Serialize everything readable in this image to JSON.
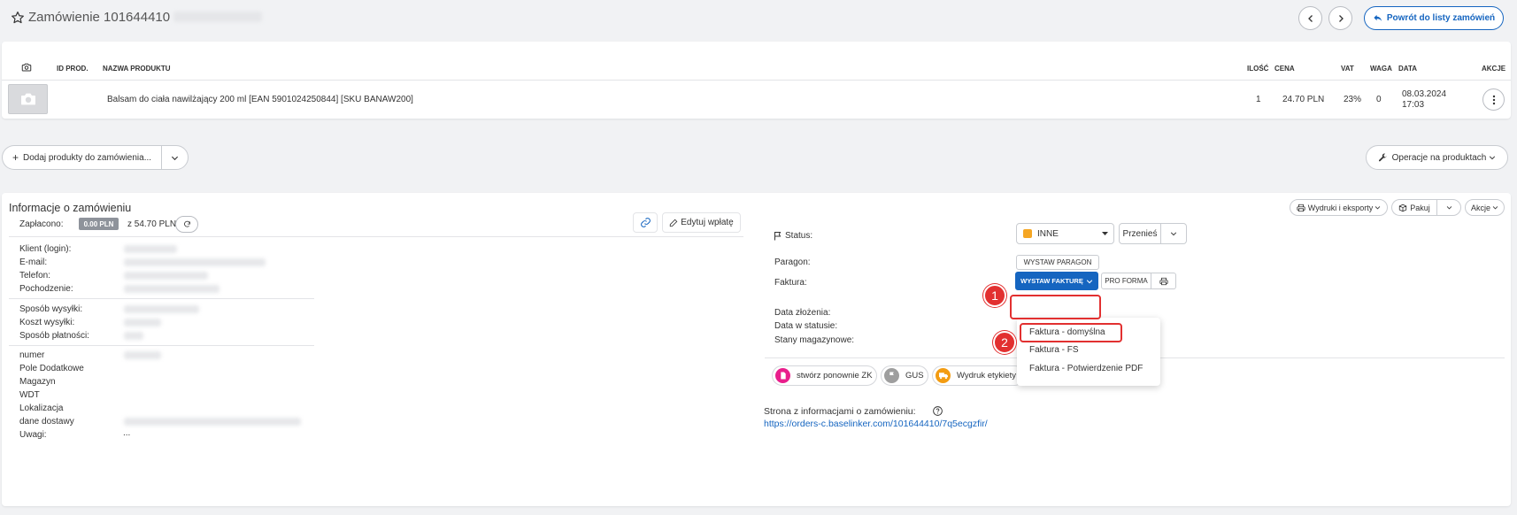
{
  "header": {
    "title": "Zamówienie 101644410",
    "back_label": "Powrót do listy zamówień"
  },
  "products_table": {
    "columns": [
      "ID PROD.",
      "NAZWA PRODUKTU",
      "ILOŚĆ",
      "CENA",
      "VAT",
      "WAGA",
      "DATA",
      "AKCJE"
    ],
    "rows": [
      {
        "name": "Balsam do ciała nawilżający 200 ml [EAN 5901024250844] [SKU BANAW200]",
        "qty": "1",
        "price": "24.70 PLN",
        "vat": "23%",
        "weight": "0",
        "date_line1": "08.03.2024",
        "date_line2": "17:03"
      }
    ]
  },
  "actions_bar": {
    "add_products_label": "Dodaj produkty do zamówienia...",
    "operations_label": "Operacje na produktach"
  },
  "info": {
    "title": "Informacje o zamówieniu",
    "prints_label": "Wydruki i eksporty",
    "pack_label": "Pakuj",
    "actions_label": "Akcje",
    "paid_label": "Zapłacono:",
    "paid_value": "0.00 PLN",
    "paid_total": "z 54.70 PLN",
    "edit_payment_label": "Edytuj wpłatę",
    "fields_group1": [
      "Klient (login):",
      "E-mail:",
      "Telefon:",
      "Pochodzenie:"
    ],
    "fields_group2": [
      "Sposób wysyłki:",
      "Koszt wysyłki:",
      "Sposób płatności:"
    ],
    "fields_group3": [
      "numer",
      "Pole Dodatkowe 2",
      "Magazyn",
      "WDT",
      "Lokalizacja",
      "dane dostawy",
      "Uwagi:"
    ],
    "notes_value": "..."
  },
  "right_panel": {
    "status_label": "Status:",
    "status_value": "INNE",
    "move_label": "Przenieś",
    "receipt_label": "Paragon:",
    "receipt_button": "WYSTAW PARAGON",
    "invoice_label": "Faktura:",
    "invoice_button": "WYSTAW FAKTURĘ",
    "proforma_button": "PRO FORMA",
    "date_submitted_label": "Data złożenia:",
    "date_status_label": "Data w statusie:",
    "stock_label": "Stany magazynowe:",
    "invoice_menu": [
      "Faktura - domyślna",
      "Faktura - FS",
      "Faktura - Potwierdzenie PDF"
    ],
    "chips": [
      "stwórz ponownie ZK",
      "GUS",
      "Wydruk etykiety"
    ],
    "order_page_label": "Strona z informacjami o zamówieniu:",
    "order_page_url": "https://orders-c.baselinker.com/101644410/7q5ecgzfir/"
  },
  "markers": [
    "1",
    "2"
  ],
  "colors": {
    "primary": "#1565c0",
    "status_inne": "#f5a623",
    "marker_red": "#e23030",
    "chip_pink": "#e91e8c",
    "chip_gray": "#9e9e9e",
    "chip_orange": "#f39c12",
    "paid_badge": "#8e939b"
  }
}
